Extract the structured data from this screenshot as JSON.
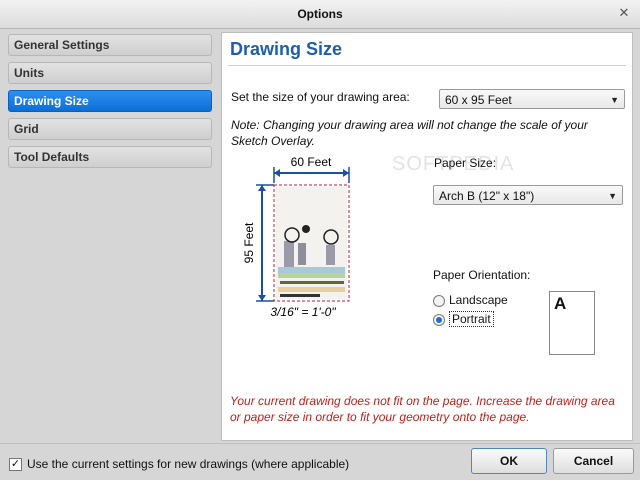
{
  "window": {
    "title": "Options",
    "close_glyph": "✕"
  },
  "nav": {
    "items": [
      {
        "label": "General Settings",
        "selected": false
      },
      {
        "label": "Units",
        "selected": false
      },
      {
        "label": "Drawing Size",
        "selected": true
      },
      {
        "label": "Grid",
        "selected": false
      },
      {
        "label": "Tool Defaults",
        "selected": false
      }
    ]
  },
  "panel": {
    "heading": "Drawing Size",
    "size_label": "Set the size of your drawing area:",
    "size_value": "60 x 95 Feet",
    "note": "Note: Changing your drawing area will not change the scale of your Sketch Overlay.",
    "width_label": "60 Feet",
    "height_label": "95 Feet",
    "scale_label": "3/16\" = 1'-0\"",
    "paper_size_label": "Paper Size:",
    "paper_size_value": "Arch B (12\" x 18\")",
    "orientation_label": "Paper Orientation:",
    "orientation_options": [
      {
        "label": "Landscape",
        "selected": false
      },
      {
        "label": "Portrait",
        "selected": true
      }
    ],
    "preview_letter": "A",
    "error_message": "Your current drawing does not fit on the page. Increase the drawing area or paper size in order to fit your geometry onto the page."
  },
  "footer": {
    "checkbox_label": "Use the current settings for new drawings (where applicable)",
    "checkbox_checked": true,
    "ok_label": "OK",
    "cancel_label": "Cancel"
  },
  "watermark": "SOFTPEDIA",
  "colors": {
    "accent": "#1d5fa8",
    "selection": "#0b6fd8",
    "error": "#c0201a",
    "dimension": "#1b4fa0",
    "page_border": "#c2183b"
  }
}
